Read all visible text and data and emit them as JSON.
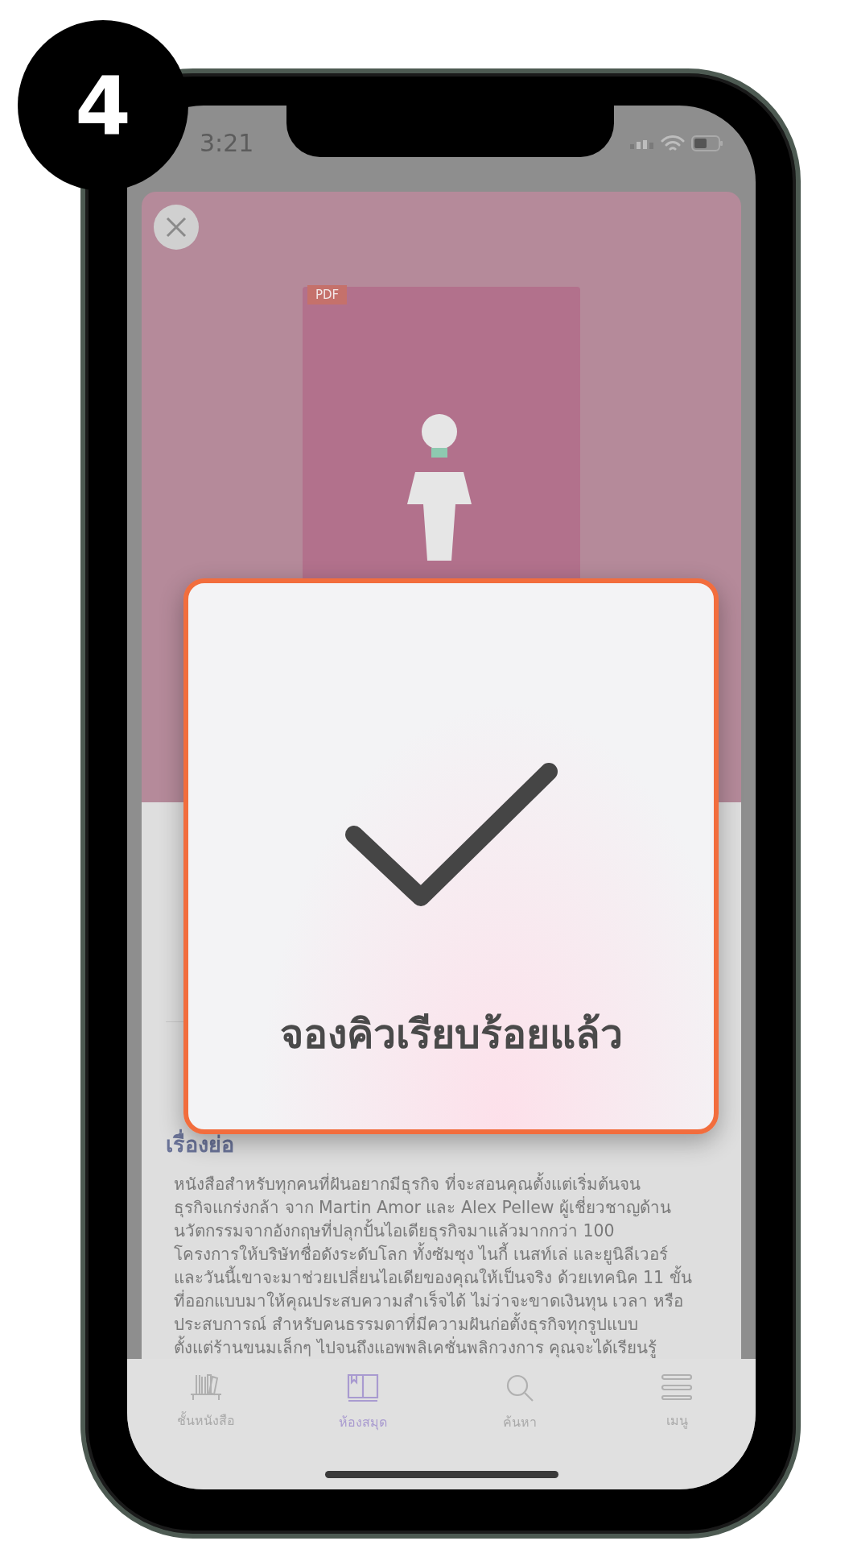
{
  "step_badge": "4",
  "status_bar": {
    "time": "3:21"
  },
  "book": {
    "format_tag": "PDF"
  },
  "dialog": {
    "message": "จองคิวเรียบร้อยแล้ว"
  },
  "synopsis": {
    "heading": "เรื่องย่อ",
    "text": "หนังสือสำหรับทุกคนที่ฝันอยากมีธุรกิจ ที่จะสอนคุณตั้งแต่เริ่มต้นจน\nธุรกิจแกร่งกล้า จาก Martin Amor และ Alex Pellew ผู้เชี่ยวชาญด้าน\nนวัตกรรมจากอังกฤษที่ปลุกปั้นไอเดียธุรกิจมาแล้วมากกว่า 100\nโครงการให้บริษัทชื่อดังระดับโลก ทั้งซัมซุง ไนกี้ เนสท์เล่ และยูนิลีเวอร์\nและวันนี้เขาจะมาช่วยเปลี่ยนไอเดียของคุณให้เป็นจริง ด้วยเทคนิค 11 ขั้น\nที่ออกแบบมาให้คุณประสบความสำเร็จได้ ไม่ว่าจะขาดเงินทุน เวลา หรือ\nประสบการณ์ สำหรับคนธรรมดาที่มีความฝันก่อตั้งธุรกิจทุกรูปแบบ\nตั้งแต่ร้านขนมเล็กๆ ไปจนถึงแอพพลิเคชั่นพลิกวงการ คุณจะได้เรียนรู้"
  },
  "tab_bar": [
    {
      "kind": "shelf",
      "label": "ชั้นหนังสือ",
      "selected": false
    },
    {
      "kind": "library",
      "label": "ห้องสมุด",
      "selected": true
    },
    {
      "kind": "search",
      "label": "ค้นหา",
      "selected": false
    },
    {
      "kind": "menu",
      "label": "เมนู",
      "selected": false
    }
  ]
}
